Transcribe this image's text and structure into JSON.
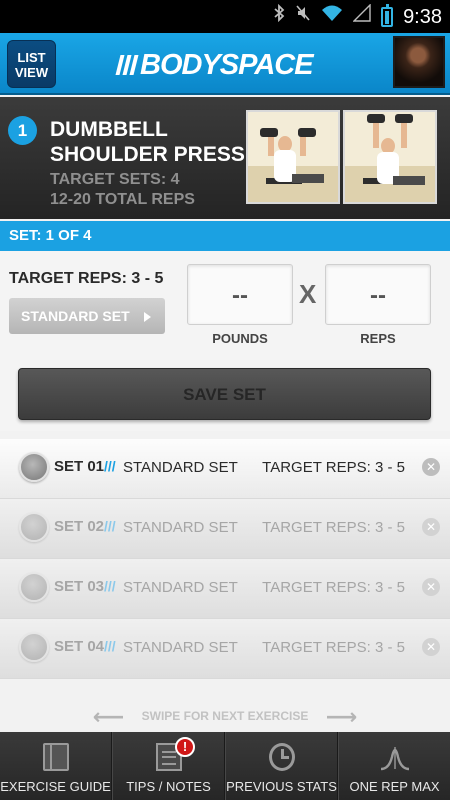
{
  "status_bar": {
    "time": "9:38",
    "icons": [
      "bluetooth-icon",
      "mute-icon",
      "wifi-icon",
      "signal-icon",
      "battery-icon"
    ]
  },
  "header": {
    "list_view_label_line1": "LIST",
    "list_view_label_line2": "VIEW",
    "logo_text": "BODYSPACE"
  },
  "exercise": {
    "number": "1",
    "title": "DUMBBELL SHOULDER PRESS",
    "target_sets": "TARGET SETS: 4",
    "total_reps": "12-20 TOTAL REPS"
  },
  "set_indicator": "SET: 1 OF 4",
  "entry": {
    "target_reps": "TARGET REPS: 3 - 5",
    "set_type": "STANDARD SET",
    "pounds_value": "--",
    "reps_value": "--",
    "times_sign": "X",
    "pounds_label": "POUNDS",
    "reps_label": "REPS",
    "save_label": "SAVE SET"
  },
  "sets": [
    {
      "name": "SET 01",
      "separator": "///",
      "type": "STANDARD SET",
      "target": "TARGET REPS: 3 - 5",
      "active": true
    },
    {
      "name": "SET 02",
      "separator": "///",
      "type": "STANDARD SET",
      "target": "TARGET REPS: 3 - 5",
      "active": false
    },
    {
      "name": "SET 03",
      "separator": "///",
      "type": "STANDARD SET",
      "target": "TARGET REPS: 3 - 5",
      "active": false
    },
    {
      "name": "SET 04",
      "separator": "///",
      "type": "STANDARD SET",
      "target": "TARGET REPS: 3 - 5",
      "active": false
    }
  ],
  "swipe_hint": "SWIPE FOR NEXT EXERCISE",
  "bottom_nav": [
    {
      "label": "EXERCISE GUIDE",
      "icon": "book-icon"
    },
    {
      "label": "TIPS / NOTES",
      "icon": "notes-icon",
      "badge": "!"
    },
    {
      "label": "PREVIOUS STATS",
      "icon": "history-clock-icon"
    },
    {
      "label": "ONE REP MAX",
      "icon": "bell-curve-icon"
    }
  ],
  "colors": {
    "accent": "#1ba1e2",
    "header": "#0f93d4",
    "alert": "#d01818"
  }
}
